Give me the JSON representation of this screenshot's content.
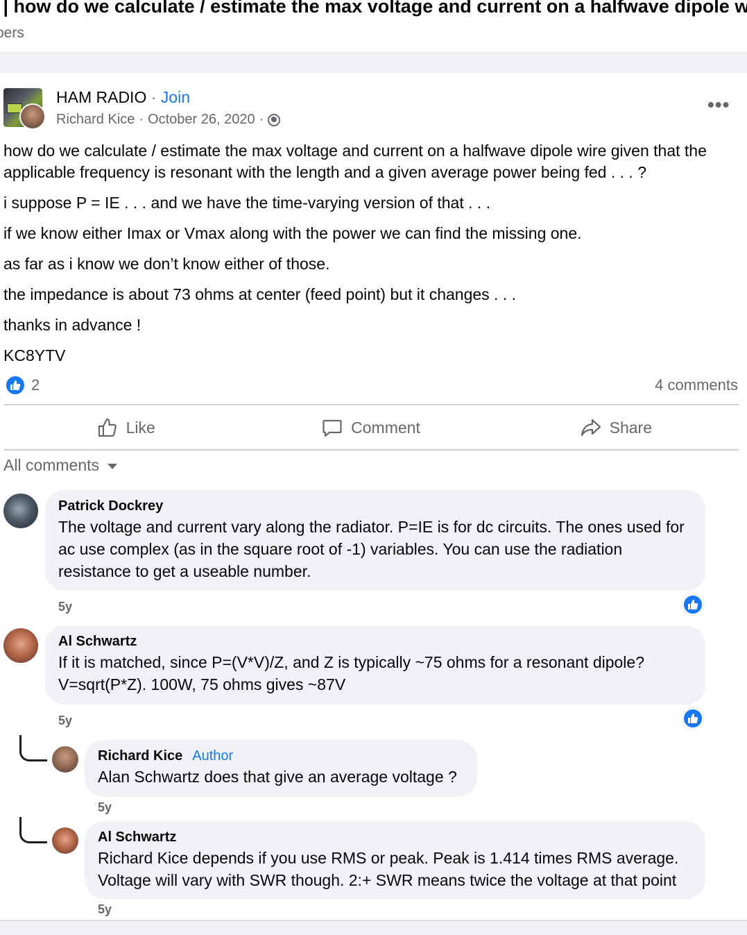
{
  "header": {
    "title": ") | how do we calculate / estimate the max voltage and current on a halfwave dipole wire ...",
    "subtitle": "bers"
  },
  "post": {
    "group_name": "HAM RADIO",
    "separator": "·",
    "join_label": "Join",
    "author": "Richard Kice",
    "date": "October 26, 2020",
    "privacy_icon": "globe-icon",
    "more_icon": "•••",
    "paragraphs": [
      "how do we calculate / estimate the max voltage and current on a halfwave dipole wire given that the applicable frequency is resonant with the length and a given average power being fed . . . ?",
      "i suppose P = IE . . . and we have the time-varying version of that . . .",
      "if we know either Imax or Vmax along with the power we can find the missing one.",
      "as far as i know we don’t know either of those.",
      "the impedance is about 73 ohms at center (feed point) but it changes . . .",
      "thanks in advance !",
      "KC8YTV"
    ],
    "reaction_count": "2",
    "comment_count": "4 comments"
  },
  "actions": {
    "like": "Like",
    "comment": "Comment",
    "share": "Share"
  },
  "comments_filter": "All comments",
  "comments": [
    {
      "name": "Patrick Dockrey",
      "text": "The voltage and current vary along the radiator. P=IE is for dc circuits. The ones used for ac use complex (as in the square root of -1) variables. You can use the radiation resistance to get a useable number.",
      "time": "5y"
    },
    {
      "name": "Al Schwartz",
      "text": "If it is matched, since P=(V*V)/Z, and Z is typically ~75 ohms for a resonant dipole? V=sqrt(P*Z). 100W, 75 ohms gives ~87V",
      "time": "5y"
    },
    {
      "name": "Richard Kice",
      "badge": "Author",
      "text": "Alan Schwartz does that give an average voltage ?",
      "time": "5y"
    },
    {
      "name": "Al Schwartz",
      "text": "Richard Kice depends if you use RMS or peak. Peak is 1.414 times RMS average. Voltage will vary with SWR though. 2:+ SWR means twice the voltage at that point",
      "time": "5y"
    }
  ],
  "colors": {
    "accent": "#1877f2",
    "muted": "#65676b",
    "bubble": "#f0f2f5"
  }
}
